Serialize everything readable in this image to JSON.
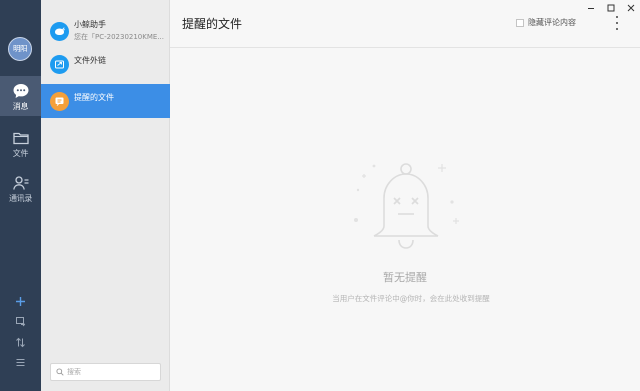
{
  "user": {
    "avatar_text": "明阳"
  },
  "rail": {
    "messages_label": "消息",
    "files_label": "文件",
    "contacts_label": "通讯录"
  },
  "conversations": [
    {
      "title": "小鲸助手",
      "subtitle": "您在「PC-20230210KME...",
      "icon": "whale-icon",
      "color": "#1d9bf0"
    },
    {
      "title": "文件外链",
      "subtitle": "",
      "icon": "link-icon",
      "color": "#1d9bf0"
    },
    {
      "title": "提醒的文件",
      "subtitle": "",
      "icon": "reminder-icon",
      "color": "#f5a03a"
    }
  ],
  "search": {
    "placeholder": "搜索"
  },
  "main": {
    "title": "提醒的文件",
    "hide_comments_label": "隐藏评论内容"
  },
  "empty_state": {
    "title": "暂无提醒",
    "description": "当用户在文件评论中@你时，会在此处收到提醒"
  },
  "colors": {
    "rail_bg": "#2f3f55",
    "accent": "#3c8ee6"
  }
}
